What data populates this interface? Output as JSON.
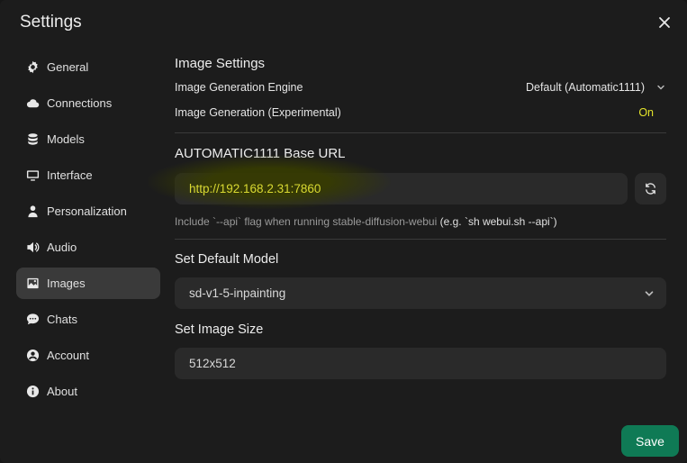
{
  "dialog": {
    "title": "Settings"
  },
  "sidebar": {
    "items": [
      {
        "label": "General",
        "icon": "gear-icon"
      },
      {
        "label": "Connections",
        "icon": "cloud-icon"
      },
      {
        "label": "Models",
        "icon": "database-icon"
      },
      {
        "label": "Interface",
        "icon": "monitor-icon"
      },
      {
        "label": "Personalization",
        "icon": "user-icon"
      },
      {
        "label": "Audio",
        "icon": "speaker-icon"
      },
      {
        "label": "Images",
        "icon": "image-icon",
        "active": true
      },
      {
        "label": "Chats",
        "icon": "chat-bubble-icon"
      },
      {
        "label": "Account",
        "icon": "user-circle-icon"
      },
      {
        "label": "About",
        "icon": "info-icon"
      }
    ]
  },
  "image_settings": {
    "title": "Image Settings",
    "engine_label": "Image Generation Engine",
    "engine_value": "Default (Automatic1111)",
    "generation_label": "Image Generation (Experimental)",
    "generation_value": "On"
  },
  "base_url": {
    "title": "AUTOMATIC1111 Base URL",
    "value": "http://192.168.2.31:7860",
    "hint_prefix": "Include `--api` flag when running stable-diffusion-webui ",
    "hint_example": "(e.g. `sh webui.sh --api`)"
  },
  "default_model": {
    "title": "Set Default Model",
    "value": "sd-v1-5-inpainting"
  },
  "image_size": {
    "title": "Set Image Size",
    "value": "512x512"
  },
  "actions": {
    "save_label": "Save"
  },
  "colors": {
    "accent": "#0f7a55",
    "highlight": "#e4e42a"
  }
}
